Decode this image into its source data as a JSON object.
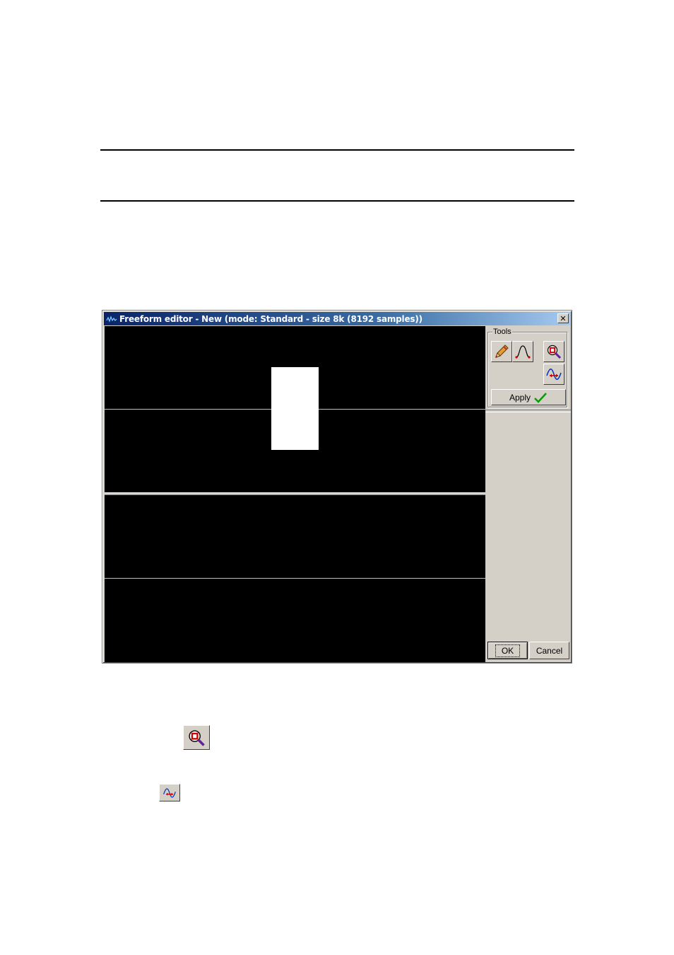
{
  "window": {
    "title": "Freeform editor - New (mode: Standard - size 8k (8192 samples))",
    "close_label": "✕"
  },
  "tools": {
    "group_label": "Tools",
    "apply_label": "Apply"
  },
  "footer": {
    "ok_label": "OK",
    "cancel_label": "Cancel"
  },
  "icons": {
    "title": "waveform-icon",
    "tools": [
      "pencil-icon",
      "curve-icon",
      "zoom-icon",
      "wave-shift-icon"
    ],
    "apply": "checkmark-icon",
    "below": [
      "zoom-icon",
      "wave-shift-icon"
    ]
  },
  "colors": {
    "plot_background": "#000000",
    "waveform": "#ffffff",
    "title_bar_start": "#0a246a",
    "title_bar_end": "#a6caf0",
    "face": "#d4d0c8",
    "check": "#00a000",
    "zoom_ring": "#d00000"
  }
}
